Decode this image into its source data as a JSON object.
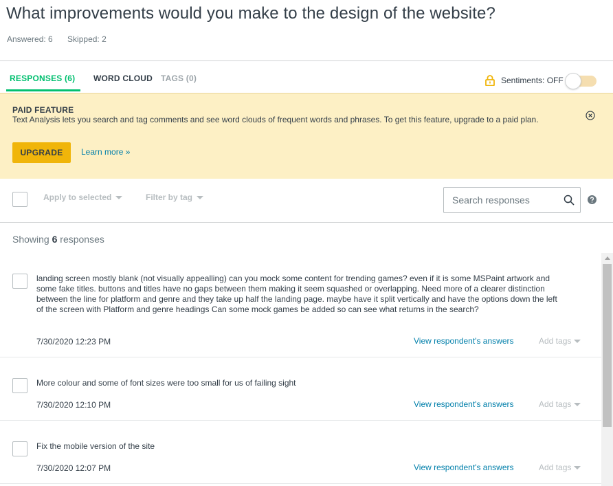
{
  "question": {
    "title": "What improvements would you make to the design of the website?",
    "answered": "Answered: 6",
    "skipped": "Skipped: 2"
  },
  "tabs": {
    "responses": "RESPONSES (6)",
    "word_cloud": "WORD CLOUD",
    "tags": "TAGS (0)"
  },
  "sentiments": {
    "label": "Sentiments: OFF",
    "state": "off"
  },
  "paid_feature": {
    "title": "PAID FEATURE",
    "text": "Text Analysis lets you search and tag comments and see word clouds of frequent words and phrases. To get this feature, upgrade to a paid plan.",
    "upgrade_label": "UPGRADE",
    "learn_more_label": "Learn more »"
  },
  "toolbar": {
    "apply_label": "Apply to selected",
    "filter_label": "Filter by tag",
    "search_placeholder": "Search responses"
  },
  "showing": {
    "prefix": "Showing",
    "count": "6",
    "suffix": "responses"
  },
  "responses": [
    {
      "text": "landing screen mostly blank (not visually appealling) can you mock some content for trending games? even if it is some MSPaint artwork and some fake titles. buttons and titles have no gaps between them making it seem squashed or overlapping. Need more of a clearer distinction between the line for platform and genre and they take up half the landing page. maybe have it split vertically and have the options down the left of the screen with Platform and genre headings Can some mock games be added so can see what returns in the search?",
      "time": "7/30/2020 12:23 PM",
      "view_label": "View respondent's answers",
      "tags_label": "Add tags"
    },
    {
      "text": "More colour and some of font sizes were too small for us of failing sight",
      "time": "7/30/2020 12:10 PM",
      "view_label": "View respondent's answers",
      "tags_label": "Add tags"
    },
    {
      "text": "Fix the mobile version of the site",
      "time": "7/30/2020 12:07 PM",
      "view_label": "View respondent's answers",
      "tags_label": "Add tags"
    }
  ],
  "colors": {
    "accent_green": "#00bf6f",
    "link_blue": "#007faa",
    "banner_bg": "#fdf0c5",
    "upgrade_yellow": "#f0b50a"
  }
}
